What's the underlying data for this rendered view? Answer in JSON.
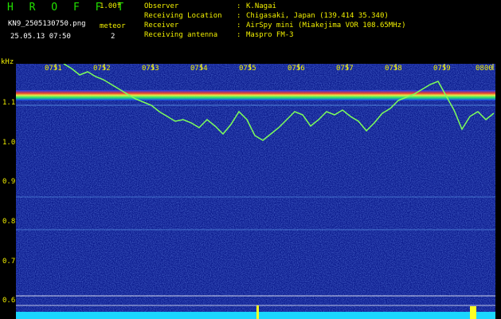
{
  "header": {
    "title": "H R O F F T",
    "version": "1.00f",
    "filename": "KN9_2505130750.png",
    "datetime": "25.05.13 07:50",
    "meteor_label": "meteor",
    "meteor_count": "2",
    "info": [
      {
        "label": "Observer",
        "value": "K.Nagai"
      },
      {
        "label": "Receiving Location",
        "value": "Chigasaki, Japan (139.414 35.340)"
      },
      {
        "label": "Receiver",
        "value": "AirSpy mini (Miakejima VOR 108.65MHz)"
      },
      {
        "label": "Receiving antenna",
        "value": "Maspro FM-3"
      }
    ]
  },
  "axis": {
    "unit": "kHz",
    "y_ticks": [
      "1.1",
      "1.0",
      "0.9",
      "0.8",
      "0.7",
      "0.6"
    ],
    "x_ticks": [
      "0751",
      "0752",
      "0753",
      "0754",
      "0755",
      "0756",
      "0757",
      "0758",
      "0759",
      "0800"
    ]
  },
  "colors": {
    "title": "#22e000",
    "text": "#f2f000",
    "background": "#000000",
    "waterfall": "#0a1a8c",
    "trace": "#7dff5a"
  }
}
